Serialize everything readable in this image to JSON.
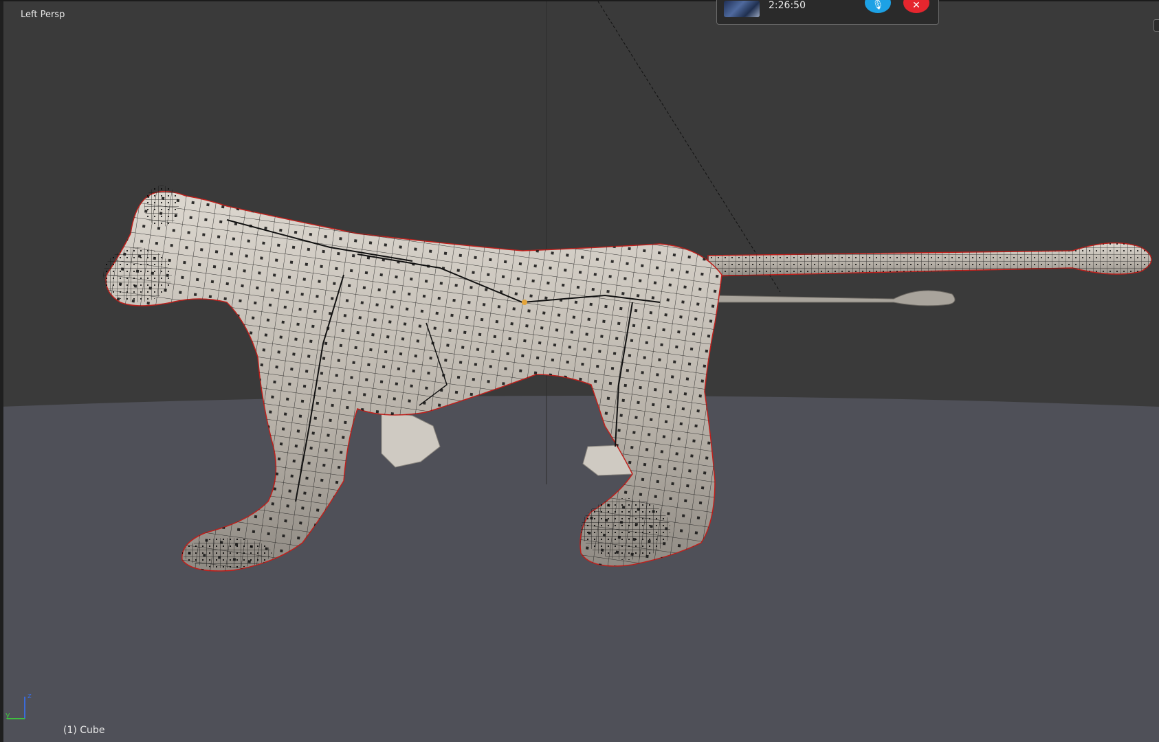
{
  "viewport": {
    "view_label": "Left Persp",
    "object_label": "(1) Cube",
    "background_color": "#3a3a3a",
    "floor_color": "#4f5058",
    "mesh_color": "#c9c4bc",
    "wire_color": "#111111",
    "seam_color": "#c0201c"
  },
  "axis_gizmo": {
    "z_label": "z",
    "y_label": "y",
    "z_color": "#3b6bd9",
    "y_color": "#3fbf3f"
  },
  "recorder": {
    "time": "2:26:50",
    "mic_icon": "microphone-icon",
    "stop_icon": "close-icon",
    "mic_color": "#1da1e5",
    "stop_color": "#e5262e"
  }
}
